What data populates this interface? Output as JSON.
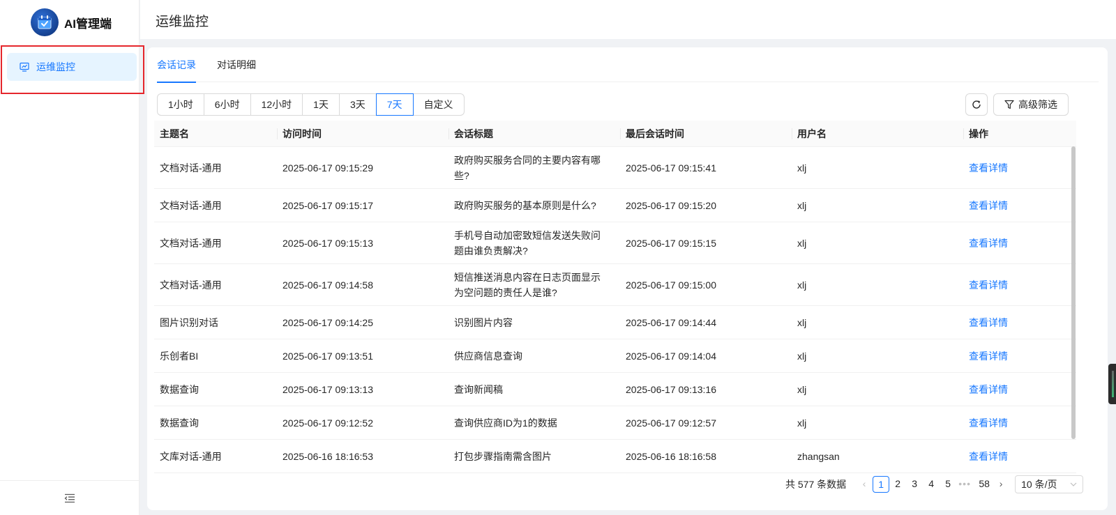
{
  "app": {
    "title": "AI管理端"
  },
  "sidebar": {
    "items": [
      {
        "label": "运维监控"
      }
    ]
  },
  "header": {
    "title": "运维监控"
  },
  "tabs": [
    {
      "label": "会话记录",
      "active": true
    },
    {
      "label": "对话明细",
      "active": false
    }
  ],
  "ranges": [
    "1小时",
    "6小时",
    "12小时",
    "1天",
    "3天",
    "7天",
    "自定义"
  ],
  "active_range": "7天",
  "toolbar": {
    "filter_label": "高级筛选"
  },
  "table": {
    "columns": [
      "主题名",
      "访问时间",
      "会话标题",
      "最后会话时间",
      "用户名",
      "操作"
    ],
    "rows": [
      {
        "topic": "文档对话-通用",
        "visit": "2025-06-17 09:15:29",
        "title": "政府购买服务合同的主要内容有哪些?",
        "last": "2025-06-17 09:15:41",
        "user": "xlj",
        "action": "查看详情"
      },
      {
        "topic": "文档对话-通用",
        "visit": "2025-06-17 09:15:17",
        "title": "政府购买服务的基本原则是什么?",
        "last": "2025-06-17 09:15:20",
        "user": "xlj",
        "action": "查看详情"
      },
      {
        "topic": "文档对话-通用",
        "visit": "2025-06-17 09:15:13",
        "title": "手机号自动加密致短信发送失败问题由谁负责解决?",
        "last": "2025-06-17 09:15:15",
        "user": "xlj",
        "action": "查看详情"
      },
      {
        "topic": "文档对话-通用",
        "visit": "2025-06-17 09:14:58",
        "title": "短信推送消息内容在日志页面显示为空问题的责任人是谁?",
        "last": "2025-06-17 09:15:00",
        "user": "xlj",
        "action": "查看详情"
      },
      {
        "topic": "图片识别对话",
        "visit": "2025-06-17 09:14:25",
        "title": "识别图片内容",
        "last": "2025-06-17 09:14:44",
        "user": "xlj",
        "action": "查看详情"
      },
      {
        "topic": "乐创者BI",
        "visit": "2025-06-17 09:13:51",
        "title": "供应商信息查询",
        "last": "2025-06-17 09:14:04",
        "user": "xlj",
        "action": "查看详情"
      },
      {
        "topic": "数据查询",
        "visit": "2025-06-17 09:13:13",
        "title": "查询新闻稿",
        "last": "2025-06-17 09:13:16",
        "user": "xlj",
        "action": "查看详情"
      },
      {
        "topic": "数据查询",
        "visit": "2025-06-17 09:12:52",
        "title": "查询供应商ID为1的数据",
        "last": "2025-06-17 09:12:57",
        "user": "xlj",
        "action": "查看详情"
      },
      {
        "topic": "文库对话-通用",
        "visit": "2025-06-16 18:16:53",
        "title": "打包步骤指南需含图片",
        "last": "2025-06-16 18:16:58",
        "user": "zhangsan",
        "action": "查看详情"
      }
    ]
  },
  "pagination": {
    "total_text": "共 577 条数据",
    "pages": [
      "1",
      "2",
      "3",
      "4",
      "5"
    ],
    "ellipsis": "•••",
    "last_page": "58",
    "current": "1",
    "page_size": "10 条/页"
  },
  "colors": {
    "accent": "#1677ff",
    "highlight_border": "#e5262c",
    "nav_bg": "#e6f4ff"
  },
  "icons": {
    "logo": "calendar-check-icon",
    "nav": "monitor-chart-icon",
    "collapse": "menu-fold-icon",
    "refresh": "refresh-icon",
    "filter": "filter-icon",
    "select": "chevron-down-icon"
  }
}
